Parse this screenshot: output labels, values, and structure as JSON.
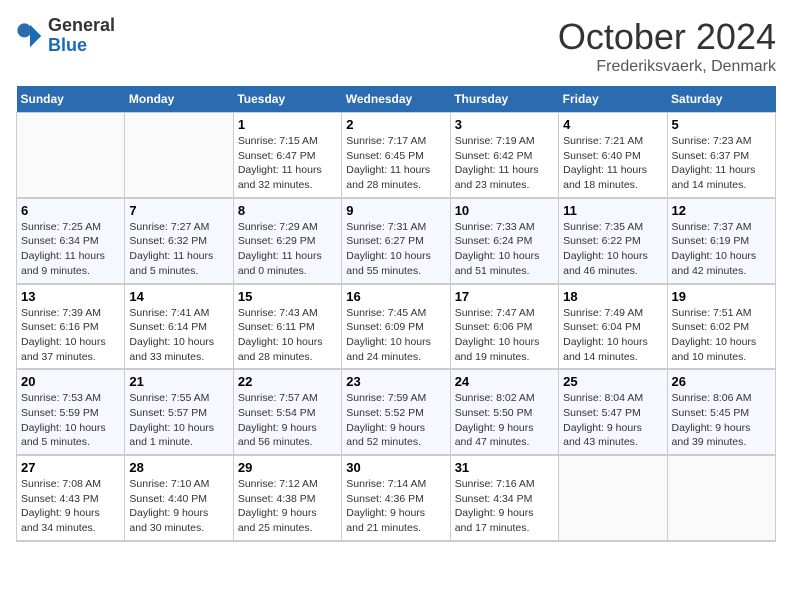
{
  "header": {
    "logo_general": "General",
    "logo_blue": "Blue",
    "month_title": "October 2024",
    "location": "Frederiksvaerk, Denmark"
  },
  "columns": [
    "Sunday",
    "Monday",
    "Tuesday",
    "Wednesday",
    "Thursday",
    "Friday",
    "Saturday"
  ],
  "weeks": [
    {
      "days": [
        {
          "num": "",
          "info": ""
        },
        {
          "num": "",
          "info": ""
        },
        {
          "num": "1",
          "info": "Sunrise: 7:15 AM\nSunset: 6:47 PM\nDaylight: 11 hours\nand 32 minutes."
        },
        {
          "num": "2",
          "info": "Sunrise: 7:17 AM\nSunset: 6:45 PM\nDaylight: 11 hours\nand 28 minutes."
        },
        {
          "num": "3",
          "info": "Sunrise: 7:19 AM\nSunset: 6:42 PM\nDaylight: 11 hours\nand 23 minutes."
        },
        {
          "num": "4",
          "info": "Sunrise: 7:21 AM\nSunset: 6:40 PM\nDaylight: 11 hours\nand 18 minutes."
        },
        {
          "num": "5",
          "info": "Sunrise: 7:23 AM\nSunset: 6:37 PM\nDaylight: 11 hours\nand 14 minutes."
        }
      ]
    },
    {
      "days": [
        {
          "num": "6",
          "info": "Sunrise: 7:25 AM\nSunset: 6:34 PM\nDaylight: 11 hours\nand 9 minutes."
        },
        {
          "num": "7",
          "info": "Sunrise: 7:27 AM\nSunset: 6:32 PM\nDaylight: 11 hours\nand 5 minutes."
        },
        {
          "num": "8",
          "info": "Sunrise: 7:29 AM\nSunset: 6:29 PM\nDaylight: 11 hours\nand 0 minutes."
        },
        {
          "num": "9",
          "info": "Sunrise: 7:31 AM\nSunset: 6:27 PM\nDaylight: 10 hours\nand 55 minutes."
        },
        {
          "num": "10",
          "info": "Sunrise: 7:33 AM\nSunset: 6:24 PM\nDaylight: 10 hours\nand 51 minutes."
        },
        {
          "num": "11",
          "info": "Sunrise: 7:35 AM\nSunset: 6:22 PM\nDaylight: 10 hours\nand 46 minutes."
        },
        {
          "num": "12",
          "info": "Sunrise: 7:37 AM\nSunset: 6:19 PM\nDaylight: 10 hours\nand 42 minutes."
        }
      ]
    },
    {
      "days": [
        {
          "num": "13",
          "info": "Sunrise: 7:39 AM\nSunset: 6:16 PM\nDaylight: 10 hours\nand 37 minutes."
        },
        {
          "num": "14",
          "info": "Sunrise: 7:41 AM\nSunset: 6:14 PM\nDaylight: 10 hours\nand 33 minutes."
        },
        {
          "num": "15",
          "info": "Sunrise: 7:43 AM\nSunset: 6:11 PM\nDaylight: 10 hours\nand 28 minutes."
        },
        {
          "num": "16",
          "info": "Sunrise: 7:45 AM\nSunset: 6:09 PM\nDaylight: 10 hours\nand 24 minutes."
        },
        {
          "num": "17",
          "info": "Sunrise: 7:47 AM\nSunset: 6:06 PM\nDaylight: 10 hours\nand 19 minutes."
        },
        {
          "num": "18",
          "info": "Sunrise: 7:49 AM\nSunset: 6:04 PM\nDaylight: 10 hours\nand 14 minutes."
        },
        {
          "num": "19",
          "info": "Sunrise: 7:51 AM\nSunset: 6:02 PM\nDaylight: 10 hours\nand 10 minutes."
        }
      ]
    },
    {
      "days": [
        {
          "num": "20",
          "info": "Sunrise: 7:53 AM\nSunset: 5:59 PM\nDaylight: 10 hours\nand 5 minutes."
        },
        {
          "num": "21",
          "info": "Sunrise: 7:55 AM\nSunset: 5:57 PM\nDaylight: 10 hours\nand 1 minute."
        },
        {
          "num": "22",
          "info": "Sunrise: 7:57 AM\nSunset: 5:54 PM\nDaylight: 9 hours\nand 56 minutes."
        },
        {
          "num": "23",
          "info": "Sunrise: 7:59 AM\nSunset: 5:52 PM\nDaylight: 9 hours\nand 52 minutes."
        },
        {
          "num": "24",
          "info": "Sunrise: 8:02 AM\nSunset: 5:50 PM\nDaylight: 9 hours\nand 47 minutes."
        },
        {
          "num": "25",
          "info": "Sunrise: 8:04 AM\nSunset: 5:47 PM\nDaylight: 9 hours\nand 43 minutes."
        },
        {
          "num": "26",
          "info": "Sunrise: 8:06 AM\nSunset: 5:45 PM\nDaylight: 9 hours\nand 39 minutes."
        }
      ]
    },
    {
      "days": [
        {
          "num": "27",
          "info": "Sunrise: 7:08 AM\nSunset: 4:43 PM\nDaylight: 9 hours\nand 34 minutes."
        },
        {
          "num": "28",
          "info": "Sunrise: 7:10 AM\nSunset: 4:40 PM\nDaylight: 9 hours\nand 30 minutes."
        },
        {
          "num": "29",
          "info": "Sunrise: 7:12 AM\nSunset: 4:38 PM\nDaylight: 9 hours\nand 25 minutes."
        },
        {
          "num": "30",
          "info": "Sunrise: 7:14 AM\nSunset: 4:36 PM\nDaylight: 9 hours\nand 21 minutes."
        },
        {
          "num": "31",
          "info": "Sunrise: 7:16 AM\nSunset: 4:34 PM\nDaylight: 9 hours\nand 17 minutes."
        },
        {
          "num": "",
          "info": ""
        },
        {
          "num": "",
          "info": ""
        }
      ]
    }
  ]
}
